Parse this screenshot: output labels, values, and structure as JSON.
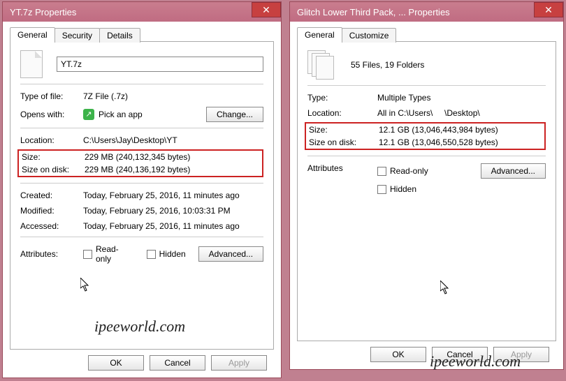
{
  "left": {
    "title": "YT.7z Properties",
    "tabs": [
      "General",
      "Security",
      "Details"
    ],
    "filename": "YT.7z",
    "type_label": "Type of file:",
    "type_value": "7Z File (.7z)",
    "opens_label": "Opens with:",
    "opens_value": "Pick an app",
    "change_btn": "Change...",
    "location_label": "Location:",
    "location_value": "C:\\Users\\Jay\\Desktop\\YT",
    "size_label": "Size:",
    "size_value": "229 MB (240,132,345 bytes)",
    "disk_label": "Size on disk:",
    "disk_value": "229 MB (240,136,192 bytes)",
    "created_label": "Created:",
    "created_value": "Today, February 25, 2016, 11 minutes ago",
    "modified_label": "Modified:",
    "modified_value": "Today, February 25, 2016, 10:03:31 PM",
    "accessed_label": "Accessed:",
    "accessed_value": "Today, February 25, 2016, 11 minutes ago",
    "attr_label": "Attributes:",
    "readonly": "Read-only",
    "hidden": "Hidden",
    "advanced": "Advanced...",
    "ok": "OK",
    "cancel": "Cancel",
    "apply": "Apply"
  },
  "right": {
    "title": "Glitch Lower Third Pack, ... Properties",
    "tabs": [
      "General",
      "Customize"
    ],
    "summary": "55 Files, 19 Folders",
    "type_label": "Type:",
    "type_value": "Multiple Types",
    "location_label": "Location:",
    "location_value": "All in C:\\Users\\     \\Desktop\\",
    "size_label": "Size:",
    "size_value": "12.1 GB (13,046,443,984 bytes)",
    "disk_label": "Size on disk:",
    "disk_value": "12.1 GB (13,046,550,528 bytes)",
    "attr_label": "Attributes",
    "readonly": "Read-only",
    "hidden": "Hidden",
    "advanced": "Advanced...",
    "ok": "OK",
    "cancel": "Cancel",
    "apply": "Apply"
  },
  "watermark": "ipeeworld.com"
}
